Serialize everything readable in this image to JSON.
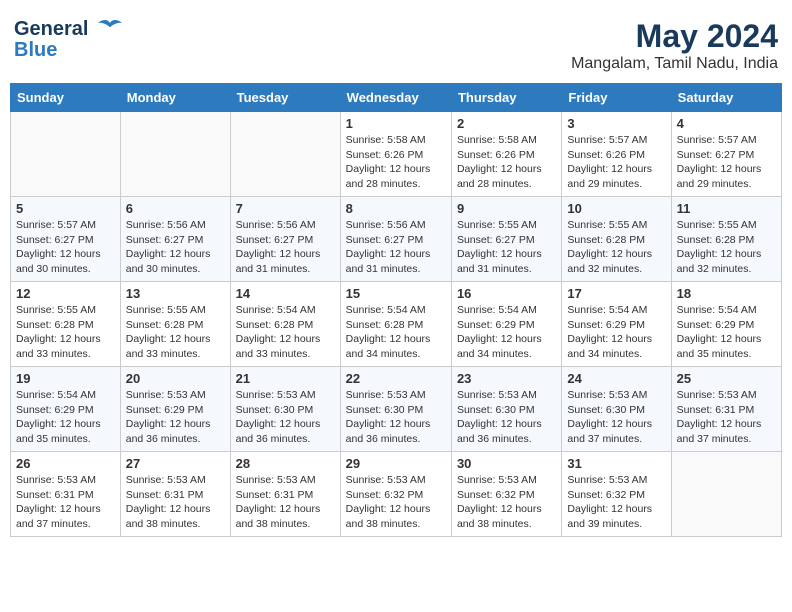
{
  "logo": {
    "line1": "General",
    "line2": "Blue"
  },
  "title": "May 2024",
  "subtitle": "Mangalam, Tamil Nadu, India",
  "weekdays": [
    "Sunday",
    "Monday",
    "Tuesday",
    "Wednesday",
    "Thursday",
    "Friday",
    "Saturday"
  ],
  "weeks": [
    [
      {
        "day": "",
        "info": ""
      },
      {
        "day": "",
        "info": ""
      },
      {
        "day": "",
        "info": ""
      },
      {
        "day": "1",
        "info": "Sunrise: 5:58 AM\nSunset: 6:26 PM\nDaylight: 12 hours\nand 28 minutes."
      },
      {
        "day": "2",
        "info": "Sunrise: 5:58 AM\nSunset: 6:26 PM\nDaylight: 12 hours\nand 28 minutes."
      },
      {
        "day": "3",
        "info": "Sunrise: 5:57 AM\nSunset: 6:26 PM\nDaylight: 12 hours\nand 29 minutes."
      },
      {
        "day": "4",
        "info": "Sunrise: 5:57 AM\nSunset: 6:27 PM\nDaylight: 12 hours\nand 29 minutes."
      }
    ],
    [
      {
        "day": "5",
        "info": "Sunrise: 5:57 AM\nSunset: 6:27 PM\nDaylight: 12 hours\nand 30 minutes."
      },
      {
        "day": "6",
        "info": "Sunrise: 5:56 AM\nSunset: 6:27 PM\nDaylight: 12 hours\nand 30 minutes."
      },
      {
        "day": "7",
        "info": "Sunrise: 5:56 AM\nSunset: 6:27 PM\nDaylight: 12 hours\nand 31 minutes."
      },
      {
        "day": "8",
        "info": "Sunrise: 5:56 AM\nSunset: 6:27 PM\nDaylight: 12 hours\nand 31 minutes."
      },
      {
        "day": "9",
        "info": "Sunrise: 5:55 AM\nSunset: 6:27 PM\nDaylight: 12 hours\nand 31 minutes."
      },
      {
        "day": "10",
        "info": "Sunrise: 5:55 AM\nSunset: 6:28 PM\nDaylight: 12 hours\nand 32 minutes."
      },
      {
        "day": "11",
        "info": "Sunrise: 5:55 AM\nSunset: 6:28 PM\nDaylight: 12 hours\nand 32 minutes."
      }
    ],
    [
      {
        "day": "12",
        "info": "Sunrise: 5:55 AM\nSunset: 6:28 PM\nDaylight: 12 hours\nand 33 minutes."
      },
      {
        "day": "13",
        "info": "Sunrise: 5:55 AM\nSunset: 6:28 PM\nDaylight: 12 hours\nand 33 minutes."
      },
      {
        "day": "14",
        "info": "Sunrise: 5:54 AM\nSunset: 6:28 PM\nDaylight: 12 hours\nand 33 minutes."
      },
      {
        "day": "15",
        "info": "Sunrise: 5:54 AM\nSunset: 6:28 PM\nDaylight: 12 hours\nand 34 minutes."
      },
      {
        "day": "16",
        "info": "Sunrise: 5:54 AM\nSunset: 6:29 PM\nDaylight: 12 hours\nand 34 minutes."
      },
      {
        "day": "17",
        "info": "Sunrise: 5:54 AM\nSunset: 6:29 PM\nDaylight: 12 hours\nand 34 minutes."
      },
      {
        "day": "18",
        "info": "Sunrise: 5:54 AM\nSunset: 6:29 PM\nDaylight: 12 hours\nand 35 minutes."
      }
    ],
    [
      {
        "day": "19",
        "info": "Sunrise: 5:54 AM\nSunset: 6:29 PM\nDaylight: 12 hours\nand 35 minutes."
      },
      {
        "day": "20",
        "info": "Sunrise: 5:53 AM\nSunset: 6:29 PM\nDaylight: 12 hours\nand 36 minutes."
      },
      {
        "day": "21",
        "info": "Sunrise: 5:53 AM\nSunset: 6:30 PM\nDaylight: 12 hours\nand 36 minutes."
      },
      {
        "day": "22",
        "info": "Sunrise: 5:53 AM\nSunset: 6:30 PM\nDaylight: 12 hours\nand 36 minutes."
      },
      {
        "day": "23",
        "info": "Sunrise: 5:53 AM\nSunset: 6:30 PM\nDaylight: 12 hours\nand 36 minutes."
      },
      {
        "day": "24",
        "info": "Sunrise: 5:53 AM\nSunset: 6:30 PM\nDaylight: 12 hours\nand 37 minutes."
      },
      {
        "day": "25",
        "info": "Sunrise: 5:53 AM\nSunset: 6:31 PM\nDaylight: 12 hours\nand 37 minutes."
      }
    ],
    [
      {
        "day": "26",
        "info": "Sunrise: 5:53 AM\nSunset: 6:31 PM\nDaylight: 12 hours\nand 37 minutes."
      },
      {
        "day": "27",
        "info": "Sunrise: 5:53 AM\nSunset: 6:31 PM\nDaylight: 12 hours\nand 38 minutes."
      },
      {
        "day": "28",
        "info": "Sunrise: 5:53 AM\nSunset: 6:31 PM\nDaylight: 12 hours\nand 38 minutes."
      },
      {
        "day": "29",
        "info": "Sunrise: 5:53 AM\nSunset: 6:32 PM\nDaylight: 12 hours\nand 38 minutes."
      },
      {
        "day": "30",
        "info": "Sunrise: 5:53 AM\nSunset: 6:32 PM\nDaylight: 12 hours\nand 38 minutes."
      },
      {
        "day": "31",
        "info": "Sunrise: 5:53 AM\nSunset: 6:32 PM\nDaylight: 12 hours\nand 39 minutes."
      },
      {
        "day": "",
        "info": ""
      }
    ]
  ]
}
